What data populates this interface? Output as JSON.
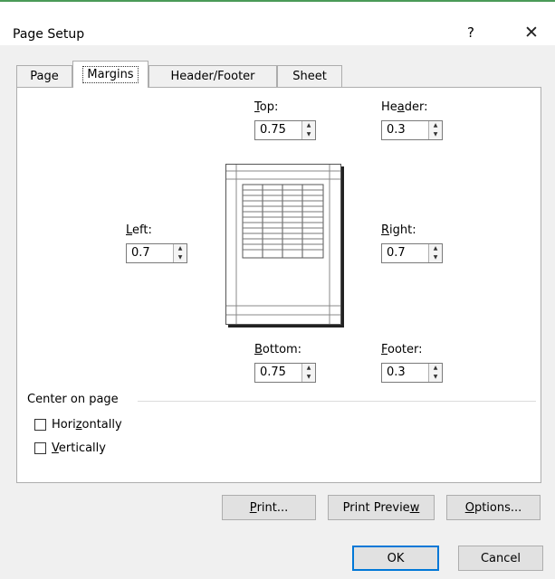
{
  "window": {
    "title": "Page Setup",
    "help_glyph": "?",
    "close_glyph": "✕"
  },
  "tabs": [
    {
      "label": "Page",
      "active": false
    },
    {
      "label": "Margins",
      "active": true
    },
    {
      "label": "Header/Footer",
      "active": false
    },
    {
      "label": "Sheet",
      "active": false
    }
  ],
  "margins": {
    "top": {
      "label_key": "T",
      "label_rest": "op:",
      "value": "0.75"
    },
    "header": {
      "label_pre": "He",
      "label_key": "a",
      "label_rest": "der:",
      "value": "0.3"
    },
    "left": {
      "label_key": "L",
      "label_rest": "eft:",
      "value": "0.7"
    },
    "right": {
      "label_key": "R",
      "label_rest": "ight:",
      "value": "0.7"
    },
    "bottom": {
      "label_key": "B",
      "label_rest": "ottom:",
      "value": "0.75"
    },
    "footer": {
      "label_key": "F",
      "label_rest": "ooter:",
      "value": "0.3"
    }
  },
  "center_on_page": {
    "label": "Center on page",
    "horizontally": {
      "label_pre": "Hori",
      "label_key": "z",
      "label_rest": "ontally",
      "checked": false
    },
    "vertically": {
      "label_key": "V",
      "label_rest": "ertically",
      "checked": false
    }
  },
  "buttons": {
    "print": {
      "label_key": "P",
      "label_rest": "rint..."
    },
    "print_preview": {
      "label_pre": "Print Previe",
      "label_key": "w"
    },
    "options": {
      "label_key": "O",
      "label_rest": "ptions..."
    },
    "ok": "OK",
    "cancel": "Cancel"
  }
}
